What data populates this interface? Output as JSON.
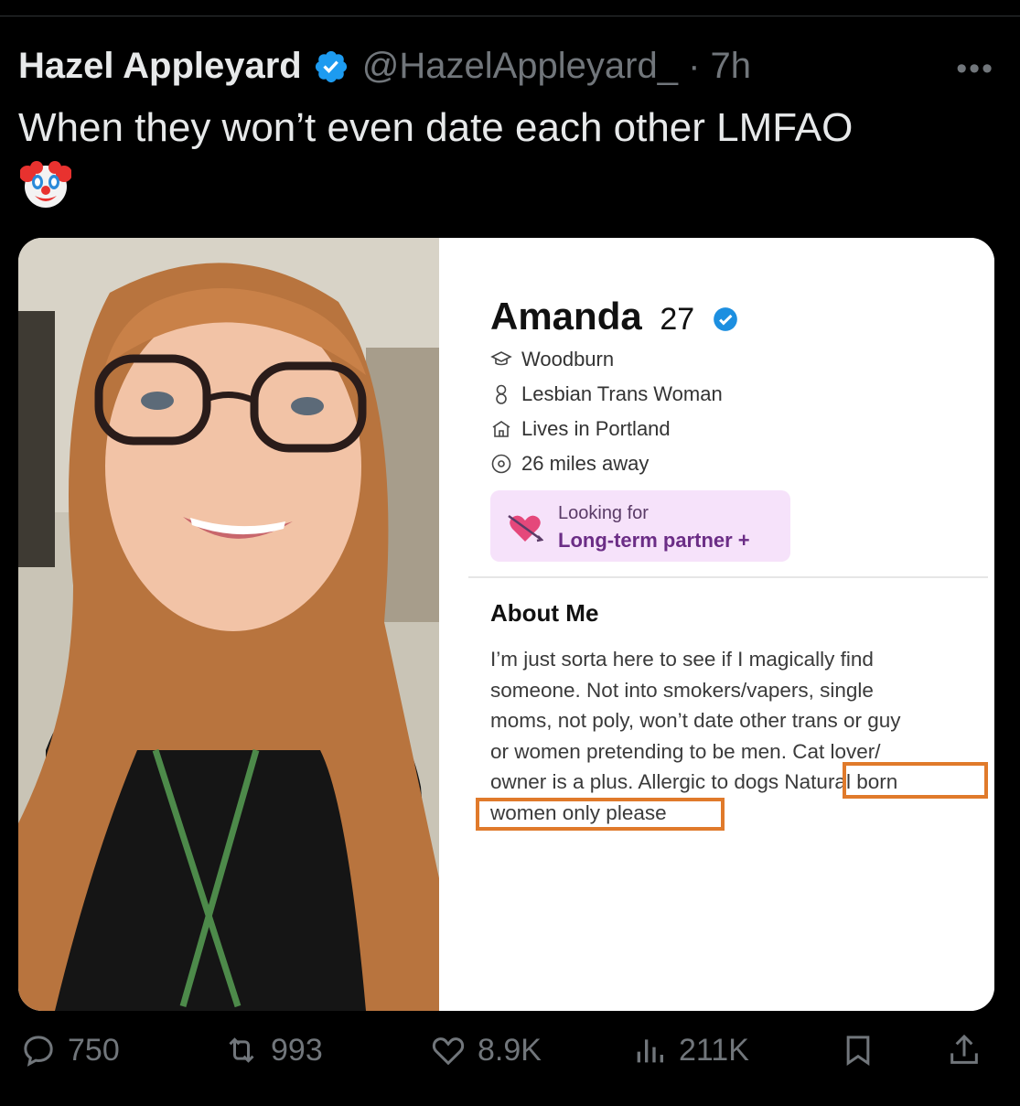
{
  "tweet": {
    "display_name": "Hazel Appleyard",
    "handle_time": "@HazelAppleyard_ · 7h",
    "more_label": "•••",
    "text": "When they won’t even date each other LMFAO",
    "emoji": "clown-face"
  },
  "profile": {
    "name": "Amanda",
    "age": "27",
    "school": "Woodburn",
    "identity": "Lesbian Trans Woman",
    "location": "Lives in Portland",
    "distance": "26 miles away",
    "looking_for_label": "Looking for",
    "looking_for_value": "Long-term partner +",
    "about_title": "About Me",
    "about_lines": [
      "I’m just sorta here to see if I magically find",
      "someone. Not into smokers/vapers, single",
      "moms, not poly, won’t date other trans or guy",
      "or women pretending to be men. Cat lover/",
      "owner is a plus. Allergic to dogs Natural born",
      "women only please"
    ],
    "highlight_color": "#e07a2b"
  },
  "actions": {
    "replies": "750",
    "reposts": "993",
    "likes": "8.9K",
    "views": "211K"
  },
  "colors": {
    "background": "#000000",
    "verified": "#1d9bf0",
    "muted": "#71767b"
  }
}
